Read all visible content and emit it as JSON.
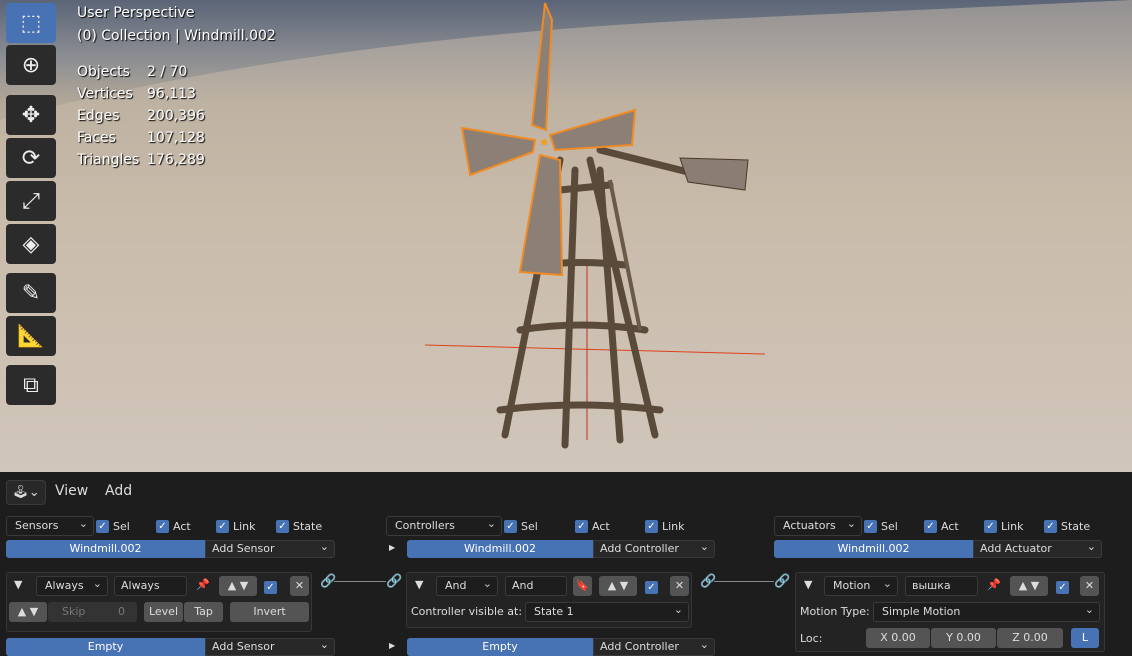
{
  "viewport": {
    "title": "User Perspective",
    "collection": "(0) Collection | Windmill.002",
    "stats": [
      {
        "label": "Objects",
        "value": "2 / 70"
      },
      {
        "label": "Vertices",
        "value": "96,113"
      },
      {
        "label": "Edges",
        "value": "200,396"
      },
      {
        "label": "Faces",
        "value": "107,128"
      },
      {
        "label": "Triangles",
        "value": "176,289"
      }
    ],
    "tools": [
      "select-box",
      "cursor",
      "move",
      "rotate",
      "scale",
      "transform",
      "annotate",
      "measure",
      "add-cube"
    ]
  },
  "header": {
    "menus": [
      "View",
      "Add"
    ]
  },
  "sensors": {
    "dropdown": "Sensors",
    "filters": [
      "Sel",
      "Act",
      "Link",
      "State"
    ],
    "object": "Windmill.002",
    "add": "Add Sensor",
    "item": {
      "type": "Always",
      "name": "Always",
      "skip_label": "Skip",
      "skip_value": "0",
      "level": "Level",
      "tap": "Tap",
      "invert": "Invert"
    },
    "object2": "Empty",
    "add2": "Add Sensor"
  },
  "controllers": {
    "dropdown": "Controllers",
    "filters": [
      "Sel",
      "Act",
      "Link"
    ],
    "object": "Windmill.002",
    "add": "Add Controller",
    "item": {
      "type": "And",
      "name": "And",
      "visible_label": "Controller visible at:",
      "state": "State 1"
    },
    "object2": "Empty",
    "add2": "Add Controller"
  },
  "actuators": {
    "dropdown": "Actuators",
    "filters": [
      "Sel",
      "Act",
      "Link",
      "State"
    ],
    "object": "Windmill.002",
    "add": "Add Actuator",
    "item": {
      "type": "Motion",
      "name": "вышка",
      "motion_type_label": "Motion Type:",
      "motion_type": "Simple Motion",
      "loc_label": "Loc:",
      "x": "X  0.00",
      "y": "Y  0.00",
      "z": "Z  0.00",
      "local": "L"
    }
  },
  "colors": {
    "accent": "#4772b3",
    "selection": "#f08a24"
  }
}
